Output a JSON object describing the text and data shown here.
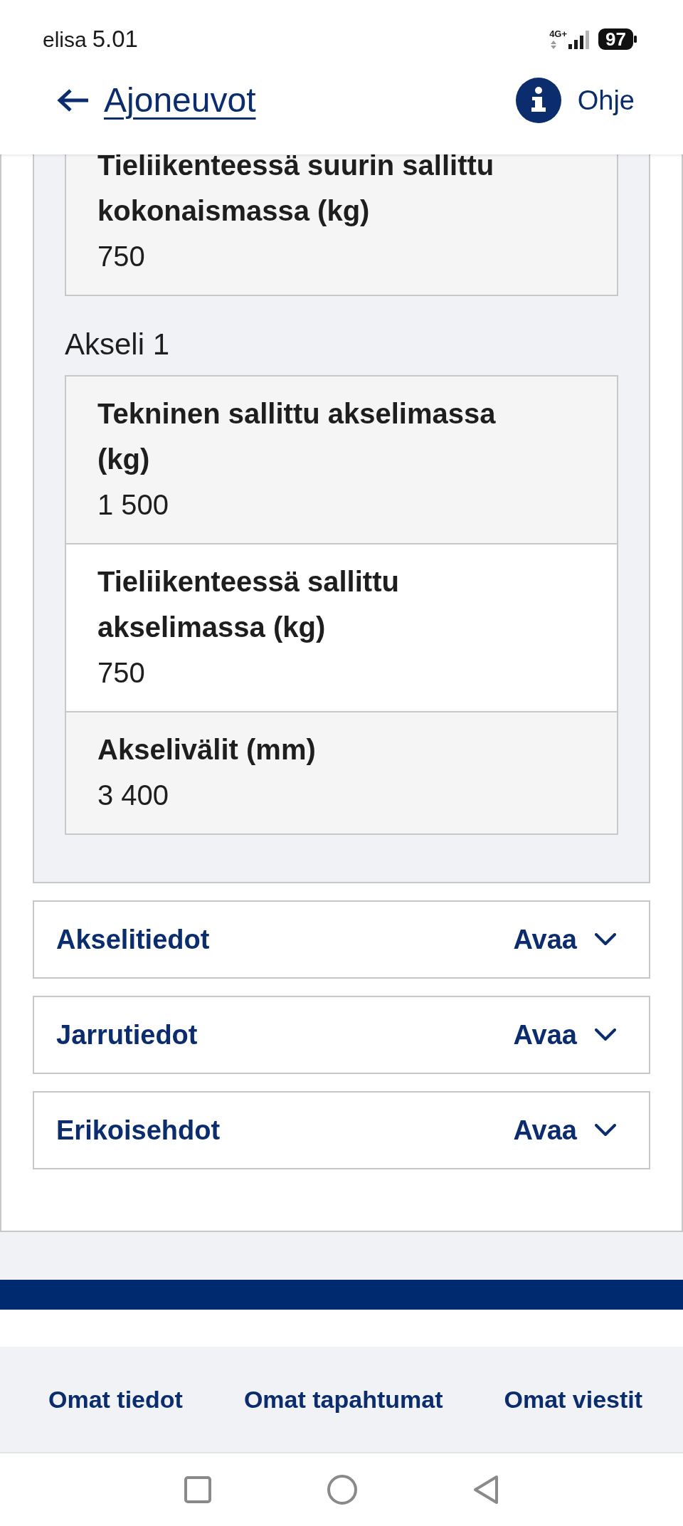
{
  "status_bar": {
    "carrier": "elisa",
    "time": "5.01",
    "network": "4G+",
    "battery": "97"
  },
  "header": {
    "back_link": "Ajoneuvot",
    "help_link": "Ohje"
  },
  "details_panel": {
    "fields": [
      {
        "label": "Tieliikenteessä suurin sallittu kokonaismassa (kg)",
        "value": "750"
      }
    ],
    "groups": [
      {
        "title": "Akseli 1",
        "fields": [
          {
            "label": "Tekninen sallittu akselimassa (kg)",
            "value": "1 500"
          },
          {
            "label": "Tieliikenteessä sallittu akselimassa (kg)",
            "value": "750"
          },
          {
            "label": "Akselivälit (mm)",
            "value": "3 400"
          }
        ]
      }
    ]
  },
  "accordions": [
    {
      "title": "Akselitiedot",
      "action": "Avaa",
      "expanded": false
    },
    {
      "title": "Jarrutiedot",
      "action": "Avaa",
      "expanded": false
    },
    {
      "title": "Erikoisehdot",
      "action": "Avaa",
      "expanded": false
    }
  ],
  "footer_links": [
    "Omat tiedot",
    "Omat tapahtumat",
    "Omat viestit"
  ]
}
